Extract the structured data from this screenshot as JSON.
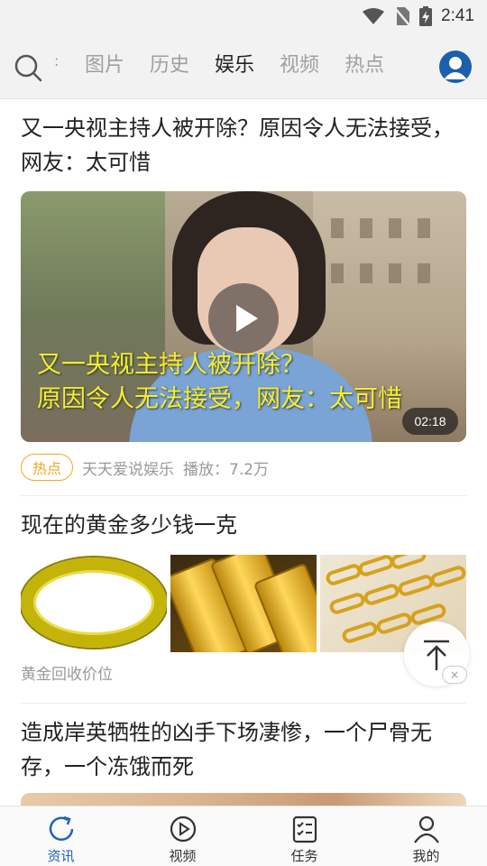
{
  "status_bar": {
    "time": "2:41",
    "icons": [
      "wifi-icon",
      "no-sim-icon",
      "battery-charging-icon"
    ]
  },
  "nav": {
    "tabs": [
      {
        "label": "图片",
        "active": false
      },
      {
        "label": "历史",
        "active": false
      },
      {
        "label": "娱乐",
        "active": true
      },
      {
        "label": "视频",
        "active": false
      },
      {
        "label": "热点",
        "active": false
      }
    ],
    "accent_color": "#1b5fae"
  },
  "feed": {
    "article1": {
      "title": "又一央视主持人被开除？原因令人无法接受，网友：太可惜",
      "video_caption_line1": "又一央视主持人被开除？",
      "video_caption_line2": "原因令人无法接受，网友：太可惜",
      "duration": "02:18",
      "badge": "热点",
      "source": "天天爱说娱乐",
      "plays": "播放：7.2万"
    },
    "article2": {
      "title": "现在的黄金多少钱一克",
      "source": "黄金回收价位",
      "close_label": "×"
    },
    "article3": {
      "title": "造成岸英牺牲的凶手下场凄惨，一个尸骨无存，一个冻饿而死"
    }
  },
  "bottom_tabs": [
    {
      "label": "资讯",
      "icon": "refresh-icon",
      "active": true
    },
    {
      "label": "视频",
      "icon": "play-circle-icon",
      "active": false
    },
    {
      "label": "任务",
      "icon": "task-list-icon",
      "active": false
    },
    {
      "label": "我的",
      "icon": "person-icon",
      "active": false
    }
  ],
  "colors": {
    "active_tab": "#1a63bd",
    "hot_badge": "#f5a623",
    "video_caption": "#f5ef2a"
  }
}
